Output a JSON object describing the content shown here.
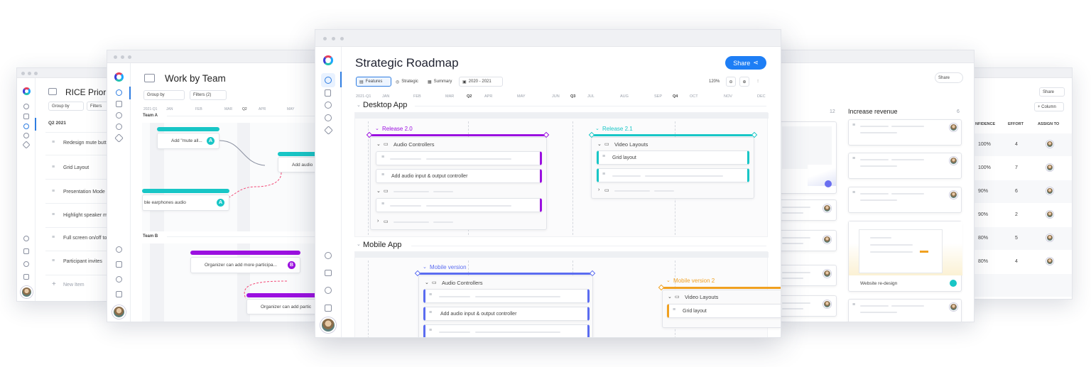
{
  "brand_colors": {
    "purple": "#9b10e0",
    "teal": "#18c6c6",
    "blue": "#2f7de1",
    "indigo": "#5b6cf0",
    "orange": "#f0a020",
    "share": "#1e7ef5"
  },
  "rice": {
    "title": "RICE Priorit",
    "group_by": "Group by",
    "filters": "Filters",
    "section": "Q2 2021",
    "items": [
      "Redesign mute butt",
      "Grid Layout",
      "Presentation Mode",
      "Highlight speaker m",
      "Full screen on/off to",
      "Participant invites"
    ],
    "new_item": "New Item"
  },
  "team": {
    "title": "Work by Team",
    "group_by": "Group by",
    "filters": "Filters (2)",
    "timeline": [
      "2021-Q1",
      "JAN",
      "FEB",
      "MAR",
      "Q2",
      "APR",
      "MAY"
    ],
    "team_a": "Team A",
    "team_b": "Team B",
    "cards": {
      "mute": "Add \"mute all...",
      "audio": "Add audio",
      "earphones": "ble earphones audio",
      "organizer1": "Organizer can add more participa...",
      "organizer2": "Organizer can add partic"
    },
    "badges": {
      "a": "A",
      "b": "B"
    }
  },
  "main": {
    "title": "Strategic Roadmap",
    "share": "Share",
    "toolbar": {
      "features": "Features",
      "strategic": "Strategic",
      "summary": "Summary",
      "range": "2020 - 2021",
      "zoom": "120%"
    },
    "timeline": [
      "2021-Q1",
      "JAN",
      "FEB",
      "MAR",
      "Q2",
      "APR",
      "MAY",
      "JUN",
      "Q3",
      "JUL",
      "AUG",
      "SEP",
      "Q4",
      "OCT",
      "NOV",
      "DEC"
    ],
    "desktop": "Desktop App",
    "mobile": "Mobile App",
    "release20": "Release 2.0",
    "release21": "Release 2.1",
    "mobile_version": "Mobile version",
    "mobile_version2": "Mobile version 2",
    "audio_controllers": "Audio Controllers",
    "video_layouts": "Video Layouts",
    "grid_layout": "Grid layout",
    "add_audio": "Add audio input & output controller"
  },
  "board": {
    "share": "Share",
    "count_left": "12",
    "column_title": "Increase revenue",
    "column_count": "6",
    "website_redesign": "Website re-design"
  },
  "rice_right": {
    "share": "Share",
    "column_btn": "+ Column",
    "headers": [
      "NFIDENCE",
      "EFFORT",
      "ASSIGN TO"
    ],
    "rows": [
      {
        "confidence": "100%",
        "effort": "4"
      },
      {
        "confidence": "100%",
        "effort": "7"
      },
      {
        "confidence": "90%",
        "effort": "6"
      },
      {
        "confidence": "90%",
        "effort": "2"
      },
      {
        "confidence": "80%",
        "effort": "5"
      },
      {
        "confidence": "80%",
        "effort": "4"
      }
    ]
  }
}
